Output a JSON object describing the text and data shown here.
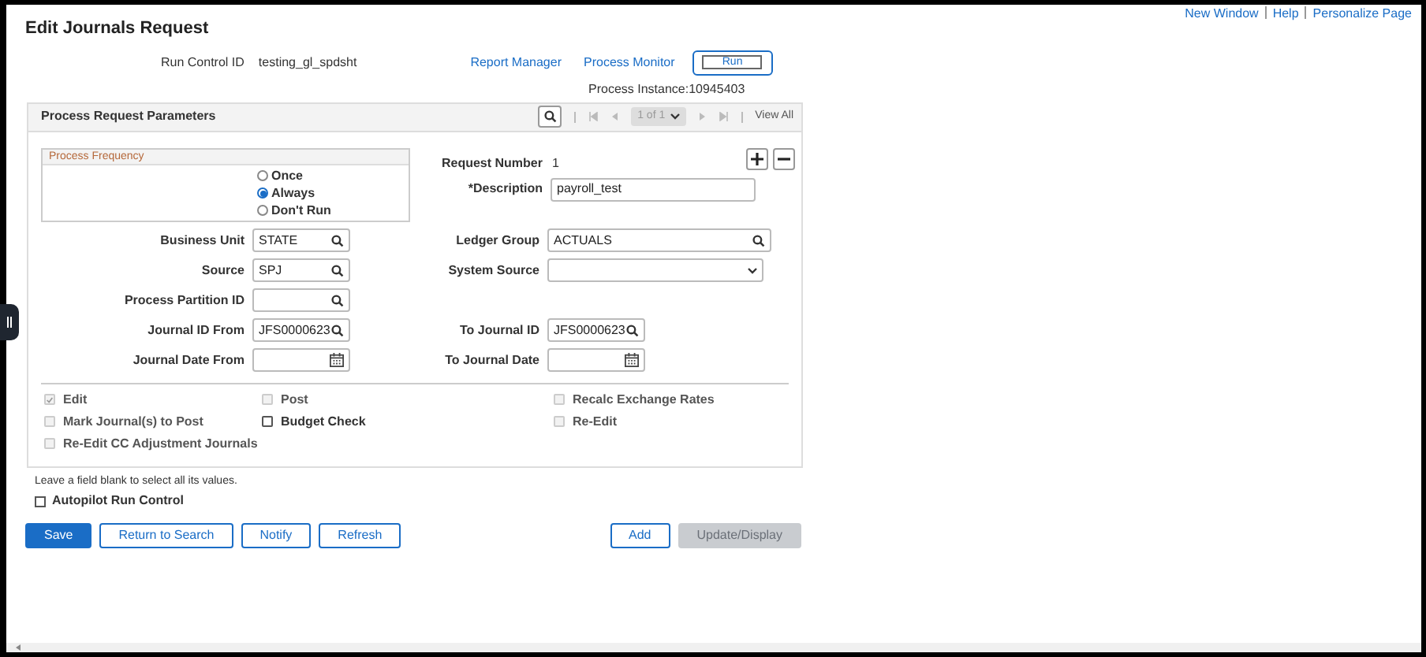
{
  "header_links": [
    "New Window",
    "Help",
    "Personalize Page"
  ],
  "title": "Edit Journals Request",
  "run_control": {
    "label": "Run Control ID",
    "value": "testing_gl_spdsht"
  },
  "top_links": [
    "Report Manager",
    "Process Monitor"
  ],
  "run_button": "Run",
  "process_instance": "Process Instance:10945403",
  "panel": {
    "title": "Process Request Parameters",
    "pager": "1 of 1",
    "view_all": "View All",
    "frequency": {
      "title": "Process Frequency",
      "options": [
        {
          "label": "Once",
          "selected": false
        },
        {
          "label": "Always",
          "selected": true
        },
        {
          "label": "Don't Run",
          "selected": false
        }
      ]
    },
    "request_number": {
      "label": "Request Number",
      "value": "1"
    },
    "description": {
      "label": "*Description",
      "value": "payroll_test"
    },
    "rows": [
      {
        "left": {
          "label": "Business Unit",
          "value": "STATE",
          "kind": "lookup"
        },
        "right": {
          "label": "Ledger Group",
          "value": "ACTUALS",
          "kind": "lookup"
        }
      },
      {
        "left": {
          "label": "Source",
          "value": "SPJ",
          "kind": "lookup"
        },
        "right": {
          "label": "System Source",
          "kind": "select"
        }
      },
      {
        "left": {
          "label": "Process Partition ID",
          "kind": "lookup"
        }
      },
      {
        "left": {
          "label": "Journal ID From",
          "value": "JFS0000623",
          "kind": "lookup"
        },
        "right": {
          "label": "To Journal ID",
          "value": "JFS0000623",
          "kind": "lookup"
        }
      },
      {
        "left": {
          "label": "Journal Date From",
          "kind": "date"
        },
        "right": {
          "label": "To Journal Date",
          "kind": "date"
        }
      }
    ],
    "checkboxes": [
      {
        "label": "Edit",
        "checked": true,
        "disabled": true
      },
      {
        "label": "Post",
        "checked": false,
        "disabled": true
      },
      {
        "label": "Recalc Exchange Rates",
        "checked": false,
        "disabled": true
      },
      {
        "label": "Mark Journal(s) to Post",
        "checked": false,
        "disabled": true
      },
      {
        "label": "Budget Check",
        "checked": false,
        "disabled": false
      },
      {
        "label": "Re-Edit",
        "checked": false,
        "disabled": true
      },
      {
        "label": "Re-Edit CC Adjustment Journals",
        "checked": false,
        "disabled": true
      }
    ]
  },
  "hint": "Leave a field blank to select all its values.",
  "autopilot": {
    "label": "Autopilot Run Control",
    "checked": false
  },
  "left_buttons": [
    {
      "label": "Save",
      "kind": "primary"
    },
    {
      "label": "Return to Search",
      "kind": "secondary"
    },
    {
      "label": "Notify",
      "kind": "secondary"
    },
    {
      "label": "Refresh",
      "kind": "secondary"
    }
  ],
  "right_buttons": [
    {
      "label": "Add",
      "kind": "secondary"
    },
    {
      "label": "Update/Display",
      "kind": "disabled"
    }
  ]
}
